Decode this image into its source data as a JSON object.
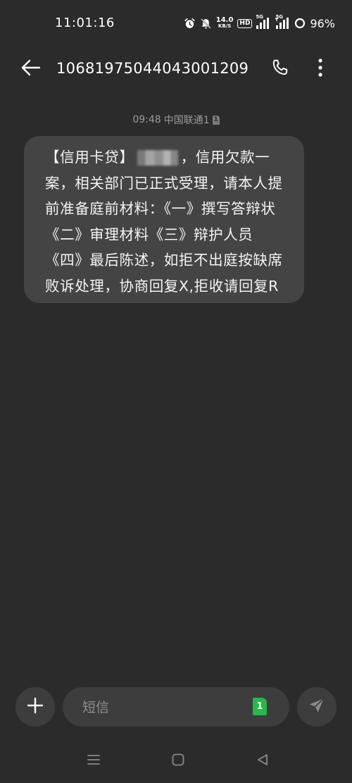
{
  "status_bar": {
    "time": "11:01:16",
    "net_speed_value": "14.0",
    "net_speed_unit": "KB/S",
    "hd_label": "HD",
    "sim1_network": "5G",
    "sim2_network": "5G",
    "battery_percent": "96%"
  },
  "header": {
    "title": "10681975044043001209",
    "back_icon": "arrow-left-icon",
    "call_icon": "phone-icon",
    "more_icon": "more-vertical-icon"
  },
  "message": {
    "time": "09:48",
    "carrier": "中国联通1",
    "sim_badge": "1",
    "text_prefix": "【信用卡贷】",
    "text_body": "，信用欠款一案，相关部门已正式受理，请本人提前准备庭前材料：《一》撰写答辩状《二》审理材料《三》辩护人员《四》最后陈述，如拒不出庭按缺席败诉处理，协商回复X,拒收请回复R"
  },
  "composer": {
    "placeholder": "短信",
    "value": "",
    "sim_label": "1",
    "add_icon": "plus-icon",
    "send_icon": "send-icon"
  },
  "nav_bar": {
    "menu_icon": "menu-icon",
    "home_icon": "home-square-icon",
    "back_icon": "back-triangle-icon"
  },
  "colors": {
    "background": "#2b2b2b",
    "bubble": "#444444",
    "controls": "#3d3d3d",
    "sim_green": "#27b74c",
    "meta_text": "#9a9a9a"
  }
}
